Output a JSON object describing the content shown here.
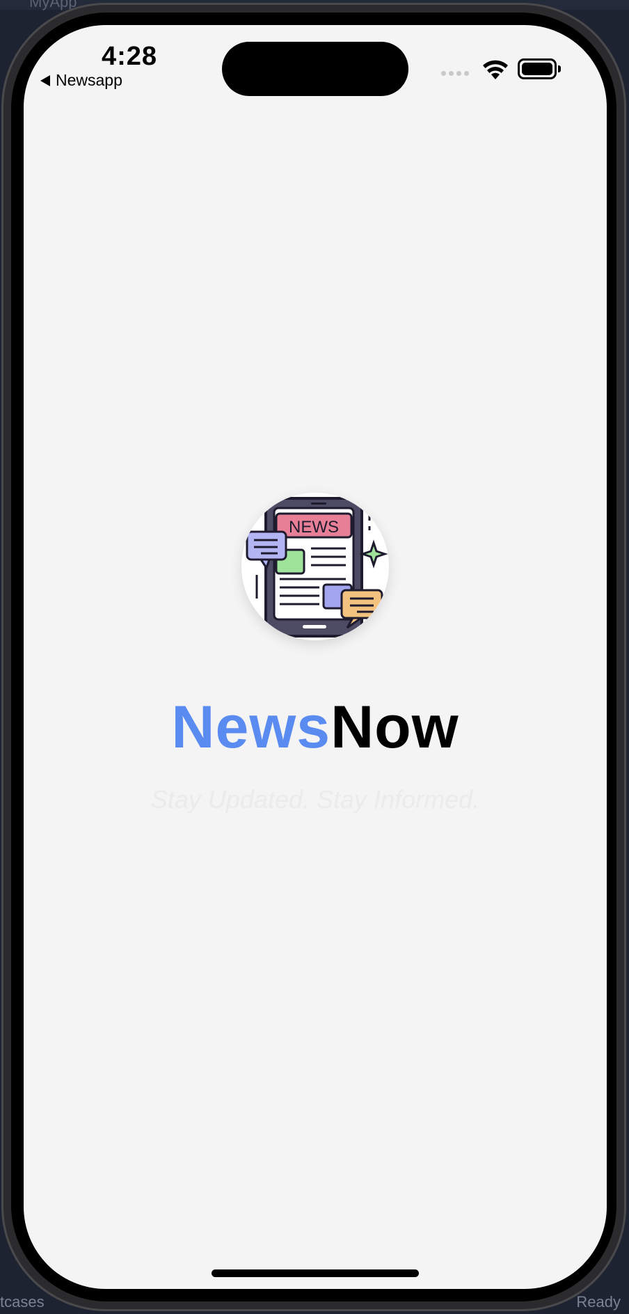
{
  "ide": {
    "top_text": "MyApp",
    "bottom_left": "tcases",
    "bottom_right": "Ready"
  },
  "status_bar": {
    "time": "4:28",
    "back_label": "Newsapp"
  },
  "logo": {
    "badge_text": "NEWS",
    "icon": "newspaper-tablet-icon"
  },
  "title": {
    "part1": "News",
    "part2": "Now",
    "part1_color": "#5a8bf0",
    "part2_color": "#000000"
  },
  "tagline": "Stay Updated. Stay Informed."
}
